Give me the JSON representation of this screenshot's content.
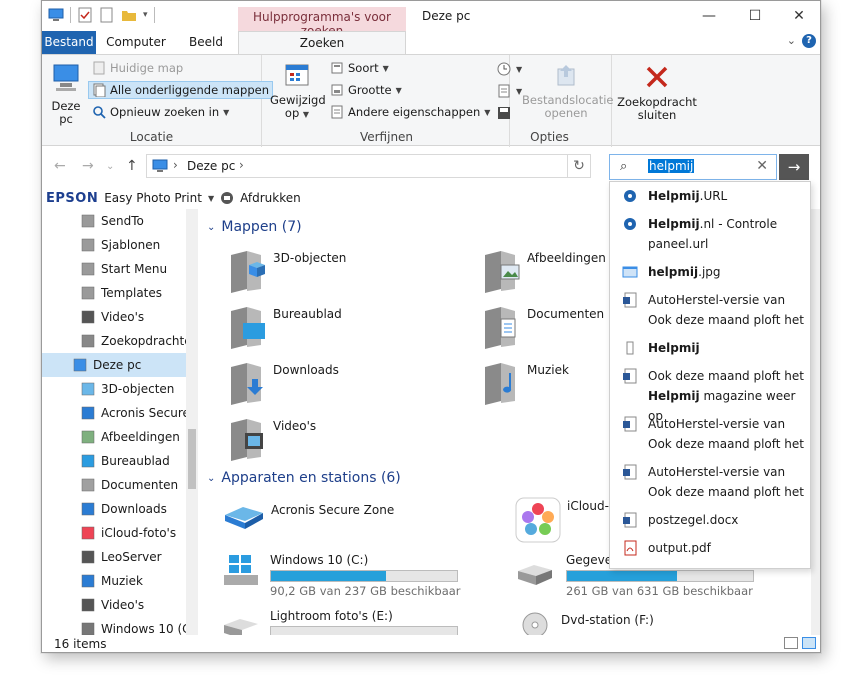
{
  "titlebar": {
    "context_tab": "Hulpprogramma's voor zoeken",
    "title": "Deze pc",
    "minimize": "—",
    "maximize": "☐",
    "close": "✕"
  },
  "tabs": [
    {
      "label": "Bestand"
    },
    {
      "label": "Computer"
    },
    {
      "label": "Beeld"
    },
    {
      "label": "Zoeken"
    }
  ],
  "ribbon": {
    "locatie": {
      "label": "Locatie",
      "deze_pc_1": "Deze",
      "deze_pc_2": "pc",
      "huidige_map": "Huidige map",
      "alle_onderliggende": "Alle onderliggende mappen",
      "opnieuw_zoeken": "Opnieuw zoeken in"
    },
    "verfijnen": {
      "label": "Verfijnen",
      "gewijzigd_1": "Gewijzigd",
      "gewijzigd_2": "op",
      "soort": "Soort",
      "grootte": "Grootte",
      "andere": "Andere eigenschappen"
    },
    "opties": {
      "label": "Opties",
      "bestandslocatie_1": "Bestandslocatie",
      "bestandslocatie_2": "openen"
    },
    "sluiten": {
      "line1": "Zoekopdracht",
      "line2": "sluiten"
    }
  },
  "address": {
    "crumb": "Deze pc"
  },
  "search": {
    "value": "helpmij"
  },
  "epson": {
    "brand": "EPSON",
    "easy_photo": "Easy Photo Print",
    "afdrukken": "Afdrukken"
  },
  "nav": [
    {
      "label": "SendTo",
      "icon": "shortcut-folder-icon"
    },
    {
      "label": "Sjablonen",
      "icon": "shortcut-folder-icon"
    },
    {
      "label": "Start Menu",
      "icon": "shortcut-folder-icon"
    },
    {
      "label": "Templates",
      "icon": "shortcut-folder-icon"
    },
    {
      "label": "Video's",
      "icon": "video-folder-icon"
    },
    {
      "label": "Zoekopdrachte",
      "icon": "search-folder-icon"
    },
    {
      "label": "Deze pc",
      "icon": "pc-icon"
    },
    {
      "label": "3D-objecten",
      "icon": "cube-folder-icon"
    },
    {
      "label": "Acronis Secure",
      "icon": "drive-folder-icon"
    },
    {
      "label": "Afbeeldingen",
      "icon": "pictures-folder-icon"
    },
    {
      "label": "Bureaublad",
      "icon": "desktop-folder-icon"
    },
    {
      "label": "Documenten",
      "icon": "documents-folder-icon"
    },
    {
      "label": "Downloads",
      "icon": "download-icon"
    },
    {
      "label": "iCloud-foto's",
      "icon": "icloud-icon"
    },
    {
      "label": "LeoServer",
      "icon": "server-icon"
    },
    {
      "label": "Muziek",
      "icon": "music-icon"
    },
    {
      "label": "Video's",
      "icon": "video-folder-icon"
    },
    {
      "label": "Windows 10 (C",
      "icon": "drive-icon"
    }
  ],
  "sections": {
    "mappen": "Mappen (7)",
    "apparaten": "Apparaten en stations (6)"
  },
  "folders": [
    {
      "label": "3D-objecten"
    },
    {
      "label": "Afbeeldingen"
    },
    {
      "label": "Bureaublad"
    },
    {
      "label": "Documenten"
    },
    {
      "label": "Downloads"
    },
    {
      "label": "Muziek"
    },
    {
      "label": "Video's"
    }
  ],
  "devices": {
    "acronis": "Acronis Secure Zone",
    "icloud": "iCloud-foto's",
    "c_name": "Windows 10 (C:)",
    "c_free": "90,2 GB van 237 GB beschikbaar",
    "c_used_fraction": 0.62,
    "d_name": "Gegevens (D:)",
    "d_free": "261 GB van 631 GB beschikbaar",
    "d_used_fraction": 0.59,
    "e_name": "Lightroom foto's (E:)",
    "f_name": "Dvd-station (F:)"
  },
  "suggestions": [
    {
      "bold": "Helpmij",
      "rest": ".URL",
      "icon": "url-icon"
    },
    {
      "bold": "Helpmij",
      "rest": ".nl - Controle paneel.url",
      "icon": "url-icon"
    },
    {
      "bold": "helpmij",
      "rest": ".jpg",
      "icon": "image-file-icon"
    },
    {
      "bold": "",
      "rest": "AutoHerstel-versie van Ook deze maand ploft het",
      "icon": "word-doc-icon"
    },
    {
      "bold": "Helpmij",
      "rest": "",
      "icon": "small-file-icon"
    },
    {
      "bold_pre": "Ook deze maand ploft het",
      "bold": "Helpmij",
      "rest": " magazine weer op",
      "icon": "word-doc-icon"
    },
    {
      "bold": "",
      "rest": "AutoHerstel-versie van Ook deze maand ploft het",
      "icon": "word-doc-icon"
    },
    {
      "bold": "",
      "rest": "AutoHerstel-versie van Ook deze maand ploft het",
      "icon": "word-doc-icon"
    },
    {
      "bold": "",
      "rest": "postzegel.docx",
      "icon": "word-doc-icon"
    },
    {
      "bold": "",
      "rest": "output.pdf",
      "icon": "pdf-icon"
    }
  ],
  "status": {
    "items": "16 items"
  },
  "colors": {
    "accent": "#1f64b0",
    "selection": "#cce4f7",
    "drive_fill": "#26a0da",
    "close_red": "#c4281c"
  }
}
